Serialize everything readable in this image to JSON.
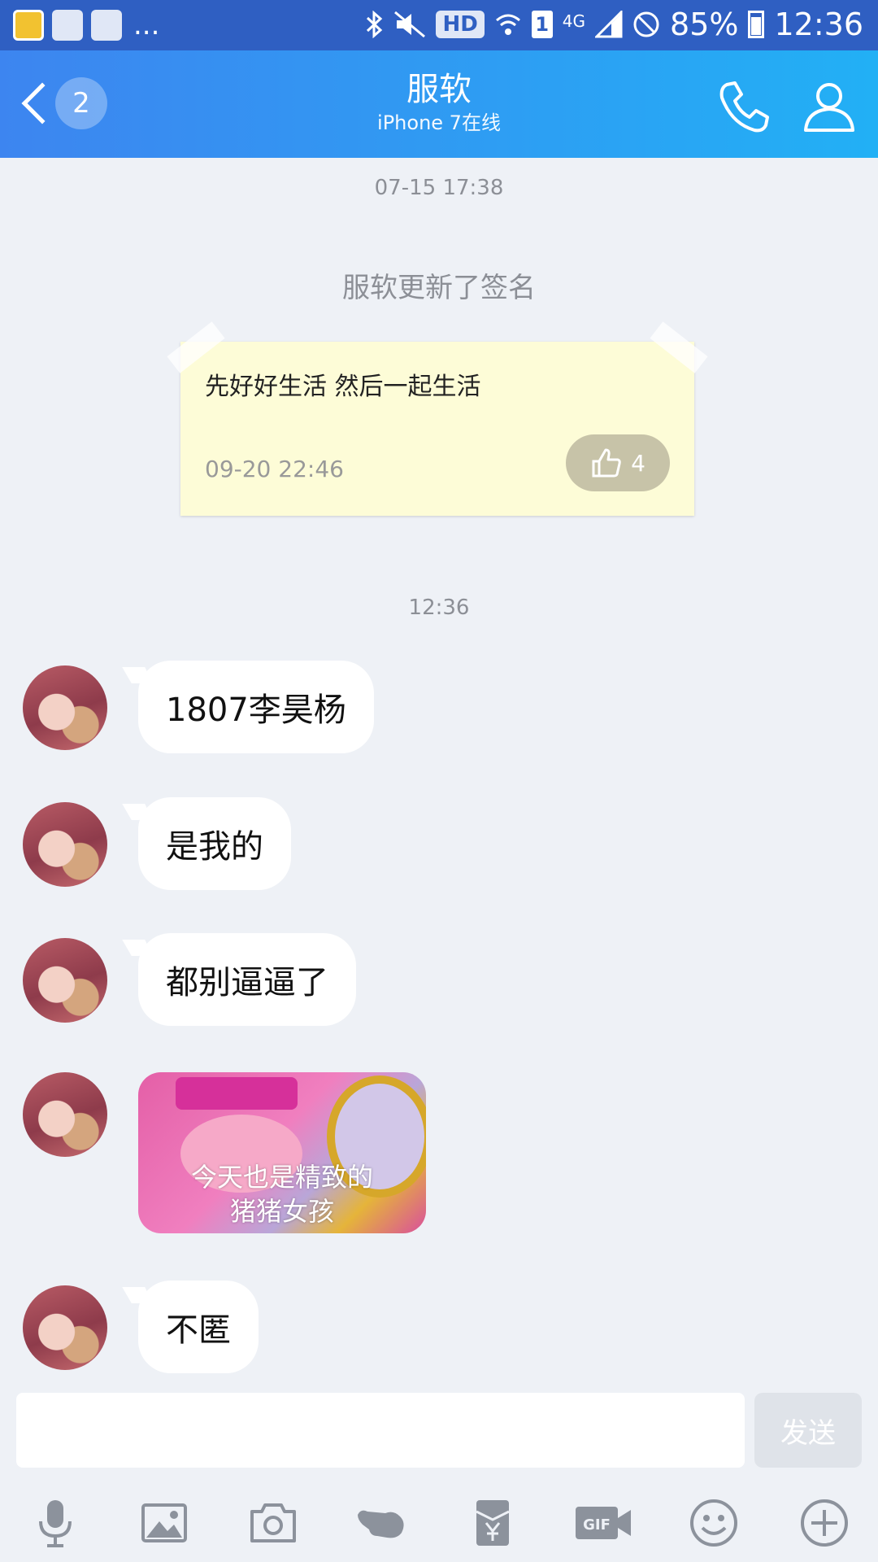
{
  "status_bar": {
    "network_label": "HD",
    "signal_type": "4G",
    "sim_number": "1",
    "battery": "85%",
    "time": "12:36",
    "more": "..."
  },
  "header": {
    "back_label": "back",
    "unread_count": "2",
    "title": "服软",
    "subtitle": "iPhone 7在线",
    "call_icon": "phone-icon",
    "profile_icon": "person-icon"
  },
  "conversation": {
    "timestamp_1": "07-15 17:38",
    "system_message": "服软更新了签名",
    "signature_card": {
      "text": "先好好生活 然后一起生活",
      "time": "09-20 22:46",
      "likes": "4"
    },
    "timestamp_2": "12:36",
    "messages": [
      {
        "type": "text",
        "text": "1807李昊杨"
      },
      {
        "type": "text",
        "text": "是我的"
      },
      {
        "type": "text",
        "text": "都别逼逼了"
      },
      {
        "type": "sticker",
        "caption_line1": "今天也是精致的",
        "caption_line2": "猪猪女孩"
      },
      {
        "type": "text",
        "text": "不匿"
      }
    ]
  },
  "composer": {
    "input_value": "",
    "send_label": "发送"
  },
  "toolbar": {
    "items": [
      "microphone-icon",
      "image-icon",
      "camera-icon",
      "hand-icon",
      "red-packet-icon",
      "gif-icon",
      "emoji-icon",
      "plus-icon"
    ]
  },
  "colors": {
    "header_start": "#3d85f0",
    "header_end": "#22b0f5",
    "background": "#eef1f6",
    "note_bg": "#fdfcd7"
  }
}
